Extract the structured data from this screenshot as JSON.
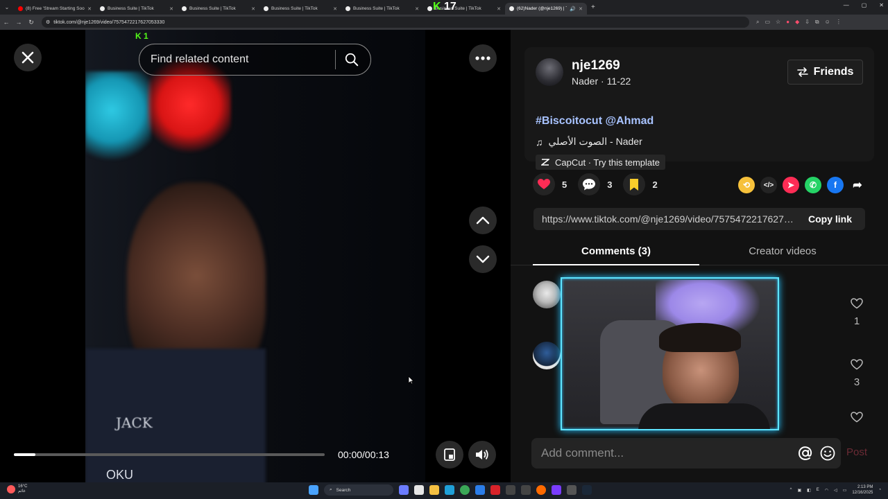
{
  "browser": {
    "tabs": [
      {
        "title": "(8) Free 'Stream Starting Soon'",
        "color": "#ff0000"
      },
      {
        "title": "Business Suite | TikTok",
        "color": "#ffffff"
      },
      {
        "title": "Business Suite | TikTok",
        "color": "#ffffff"
      },
      {
        "title": "Business Suite | TikTok",
        "color": "#ffffff"
      },
      {
        "title": "Business Suite | TikTok",
        "color": "#ffffff"
      },
      {
        "title": "Business Suite | TikTok",
        "overlay": "17",
        "color": "#ffffff"
      },
      {
        "title": "(62)Nader (@nje1269) | Tik",
        "color": "#ffffff",
        "active": true
      }
    ],
    "url": "tiktok.com/@nje1269/video/7575472217627053330"
  },
  "video": {
    "search_placeholder": "Find related content",
    "time": "00:00/00:13",
    "progress_fraction": 0.07,
    "shirt_text": "JACK",
    "shirt_text2": "OKU",
    "kick_text": "K 1"
  },
  "post": {
    "username": "nje1269",
    "subline": "Nader · 11-22",
    "friends_label": "Friends",
    "hashtag1": "#Biscoitocut",
    "mention": "@Ahmad",
    "music": "الصوت الأصلي - Nader",
    "capcut": "CapCut · Try this template",
    "likes": "5",
    "comments": "3",
    "saves": "2",
    "link": "https://www.tiktok.com/@nje1269/video/7575472217627053330",
    "copy_link": "Copy link",
    "tab_comments": "Comments (3)",
    "tab_creator": "Creator videos",
    "comment_likes": [
      "1",
      "3"
    ],
    "comment_placeholder": "Add comment...",
    "post_label": "Post"
  },
  "taskbar": {
    "weather_temp": "16°C",
    "weather_desc": "غائم",
    "search_label": "Search",
    "time": "2:13 PM",
    "date": "12/16/2025",
    "lang": "E"
  },
  "colors": {
    "accent_red": "#fe2c55",
    "hashtag_blue": "#a8c3ff",
    "cam_border": "#5fe5ff"
  }
}
